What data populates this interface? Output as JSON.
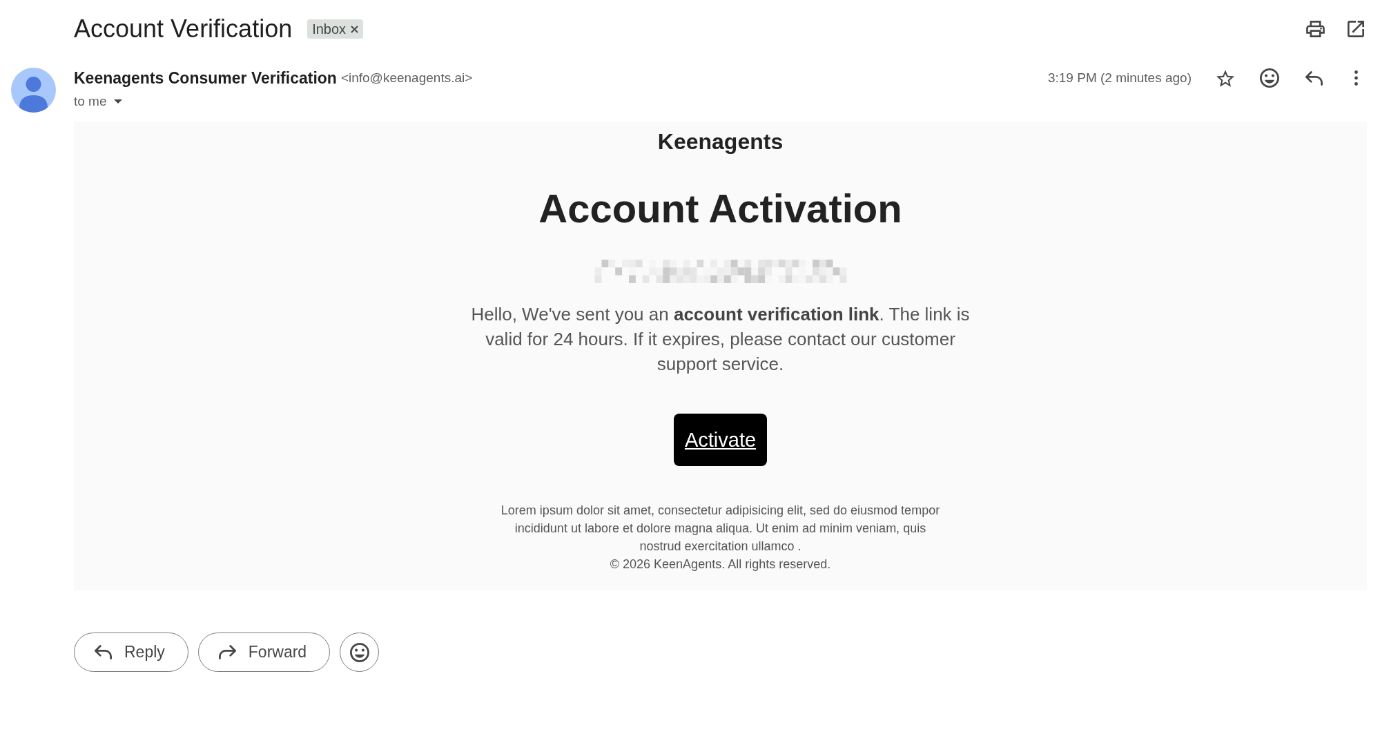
{
  "header": {
    "subject": "Account Verification",
    "labels": [
      {
        "label": "Inbox",
        "removable": true
      }
    ]
  },
  "message": {
    "sender_name": "Keenagents Consumer Verification",
    "sender_email": "<info@keenagents.ai>",
    "recipient": "to me",
    "time": "3:19 PM (2 minutes ago)",
    "starred": false,
    "body": {
      "brand": "Keenagents",
      "heading": "Account Activation",
      "redacted_line": true,
      "paragraph": "Hello, We've sent you an **account verification link**. The link is valid for 24 hours. If it expires, please contact our customer support service.",
      "button": "Activate",
      "footer_text": "Lorem ipsum dolor sit amet, consectetur adipisicing elit, sed do eiusmod tempor incididunt ut labore et dolore magna aliqua. Ut enim ad minim veniam, quis nostrud exercitation ullamco .",
      "copyright": "© 2026 KeenAgents. All rights reserved."
    }
  },
  "actions": [
    {
      "kind": "reply",
      "label": "Reply"
    },
    {
      "kind": "forward",
      "label": "Forward"
    },
    {
      "kind": "emoji"
    }
  ]
}
